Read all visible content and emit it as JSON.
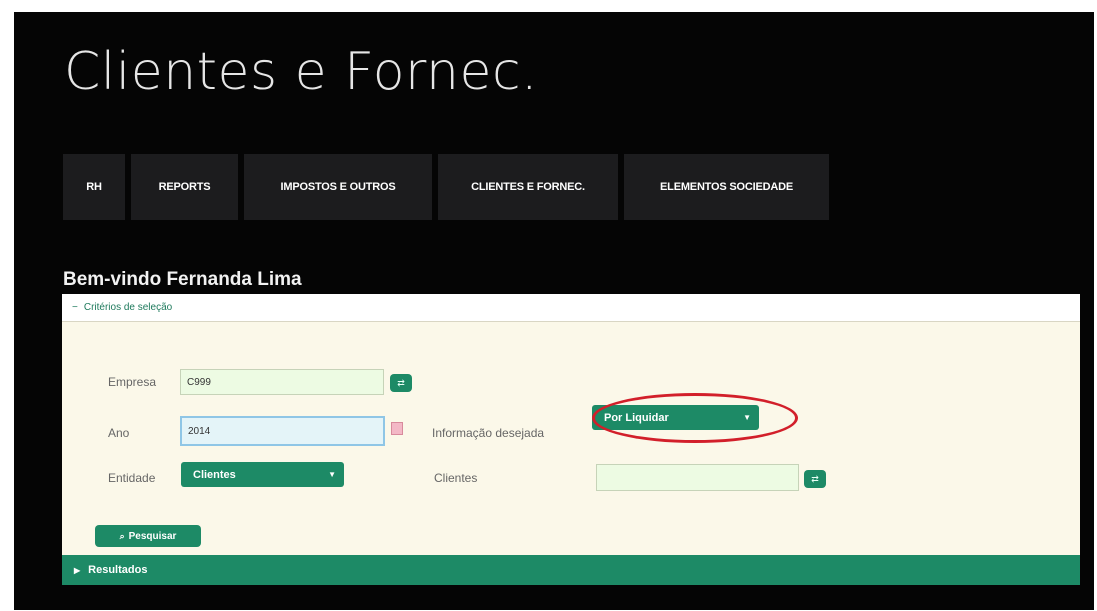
{
  "app": {
    "title": "Clientes e Fornec."
  },
  "nav": {
    "items": [
      {
        "label": "RH"
      },
      {
        "label": "REPORTS"
      },
      {
        "label": "IMPOSTOS E OUTROS"
      },
      {
        "label": "CLIENTES E FORNEC."
      },
      {
        "label": "ELEMENTOS SOCIEDADE"
      }
    ]
  },
  "welcome": "Bem-vindo Fernanda Lima",
  "criteria": {
    "header": "Critérios de seleção",
    "toggle_icon": "minus-icon",
    "empresa": {
      "label": "Empresa",
      "value": "C999"
    },
    "ano": {
      "label": "Ano",
      "value": "2014"
    },
    "entidade": {
      "label": "Entidade",
      "selected": "Clientes"
    },
    "informacao": {
      "label": "Informação desejada",
      "selected": "Por Liquidar"
    },
    "clientes": {
      "label": "Clientes",
      "value": ""
    },
    "search_button": "Pesquisar"
  },
  "results": {
    "label": "Resultados",
    "toggle_icon": "triangle-right-icon"
  },
  "colors": {
    "accent": "#1d8a66",
    "background": "#050505",
    "panel": "#fbf8e9",
    "input": "#edfbe3",
    "highlight": "#d21f2a"
  }
}
